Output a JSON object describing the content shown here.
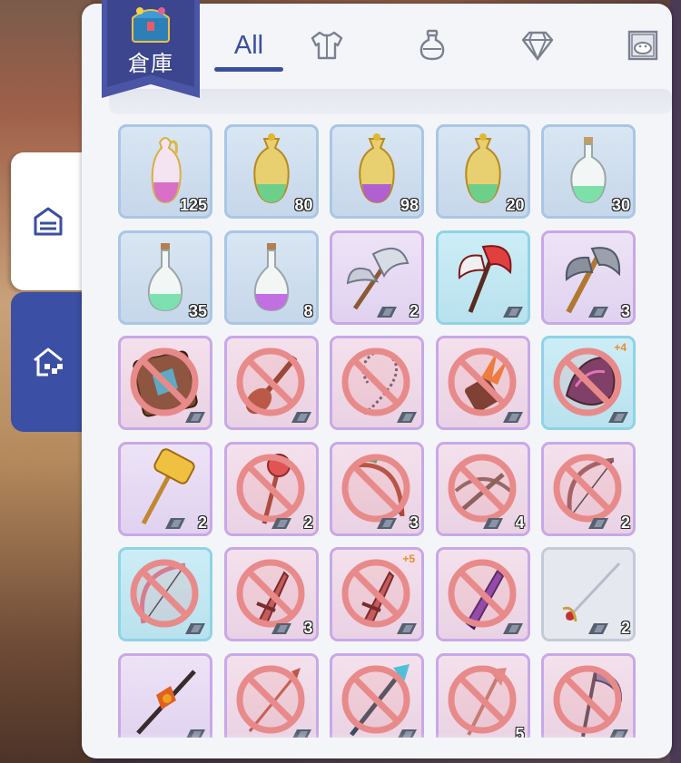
{
  "window": {
    "title": "倉庫"
  },
  "side_tabs": [
    {
      "name": "storage",
      "icon": "storage-box-icon",
      "active": true
    },
    {
      "name": "guild-storage",
      "icon": "guild-house-icon",
      "active": false
    }
  ],
  "tabs": [
    {
      "label": "All",
      "icon": null,
      "active": true
    },
    {
      "label": "",
      "icon": "armor-icon",
      "active": false
    },
    {
      "label": "",
      "icon": "potion-icon",
      "active": false
    },
    {
      "label": "",
      "icon": "gem-icon",
      "active": false
    },
    {
      "label": "",
      "icon": "card-icon",
      "active": false
    }
  ],
  "colors": {
    "accent": "#3a4fa0",
    "slot_blue": "#a9c6e6",
    "slot_purple": "#c8a8e8",
    "slot_teal": "#8fd3e6",
    "refine_orange": "#f08a2a",
    "forbid_red": "#e88a8a"
  },
  "items": [
    {
      "name": "pink-potion-vial",
      "rarity": "blue",
      "qty": "125",
      "forbidden": false,
      "lock": false,
      "refine": ""
    },
    {
      "name": "green-ornate-flask",
      "rarity": "blue",
      "qty": "80",
      "forbidden": false,
      "lock": false,
      "refine": ""
    },
    {
      "name": "purple-ornate-flask",
      "rarity": "blue",
      "qty": "98",
      "forbidden": false,
      "lock": false,
      "refine": ""
    },
    {
      "name": "green-ornate-flask",
      "rarity": "blue",
      "qty": "20",
      "forbidden": false,
      "lock": false,
      "refine": ""
    },
    {
      "name": "green-round-flask",
      "rarity": "blue",
      "qty": "30",
      "forbidden": false,
      "lock": false,
      "refine": ""
    },
    {
      "name": "green-bottle",
      "rarity": "blue",
      "qty": "35",
      "forbidden": false,
      "lock": false,
      "refine": ""
    },
    {
      "name": "purple-bottle",
      "rarity": "blue",
      "qty": "8",
      "forbidden": false,
      "lock": false,
      "refine": ""
    },
    {
      "name": "silver-battle-axe",
      "rarity": "purple",
      "qty": "2",
      "forbidden": false,
      "lock": true,
      "refine": ""
    },
    {
      "name": "red-axe",
      "rarity": "teal",
      "qty": "",
      "forbidden": false,
      "lock": true,
      "refine": ""
    },
    {
      "name": "wooden-axe",
      "rarity": "purple",
      "qty": "3",
      "forbidden": false,
      "lock": true,
      "refine": ""
    },
    {
      "name": "spell-book",
      "rarity": "pink",
      "qty": "",
      "forbidden": true,
      "lock": true,
      "refine": ""
    },
    {
      "name": "guitar",
      "rarity": "pink",
      "qty": "",
      "forbidden": true,
      "lock": true,
      "refine": ""
    },
    {
      "name": "rosary-whip",
      "rarity": "pink",
      "qty": "",
      "forbidden": true,
      "lock": true,
      "refine": ""
    },
    {
      "name": "flame-katar",
      "rarity": "pink",
      "qty": "",
      "forbidden": true,
      "lock": true,
      "refine": ""
    },
    {
      "name": "demon-claw",
      "rarity": "teal",
      "qty": "",
      "forbidden": true,
      "lock": true,
      "refine": "+4"
    },
    {
      "name": "golden-hammer",
      "rarity": "purple",
      "qty": "2",
      "forbidden": false,
      "lock": true,
      "refine": ""
    },
    {
      "name": "red-mace",
      "rarity": "pink",
      "qty": "2",
      "forbidden": true,
      "lock": true,
      "refine": ""
    },
    {
      "name": "vine-bow",
      "rarity": "pink",
      "qty": "3",
      "forbidden": true,
      "lock": true,
      "refine": ""
    },
    {
      "name": "crossbow",
      "rarity": "pink",
      "qty": "4",
      "forbidden": true,
      "lock": true,
      "refine": ""
    },
    {
      "name": "long-bow",
      "rarity": "pink",
      "qty": "2",
      "forbidden": true,
      "lock": true,
      "refine": ""
    },
    {
      "name": "pink-bow",
      "rarity": "teal",
      "qty": "",
      "forbidden": true,
      "lock": true,
      "refine": ""
    },
    {
      "name": "red-dagger",
      "rarity": "pink",
      "qty": "3",
      "forbidden": true,
      "lock": true,
      "refine": ""
    },
    {
      "name": "red-dagger",
      "rarity": "pink",
      "qty": "",
      "forbidden": true,
      "lock": true,
      "refine": "+5"
    },
    {
      "name": "purple-spear-tip",
      "rarity": "pink",
      "qty": "",
      "forbidden": true,
      "lock": true,
      "refine": ""
    },
    {
      "name": "rapier",
      "rarity": "plain",
      "qty": "2",
      "forbidden": false,
      "lock": true,
      "refine": ""
    },
    {
      "name": "dark-spear",
      "rarity": "purple",
      "qty": "",
      "forbidden": false,
      "lock": true,
      "refine": ""
    },
    {
      "name": "thin-spear",
      "rarity": "pink",
      "qty": "",
      "forbidden": true,
      "lock": true,
      "refine": ""
    },
    {
      "name": "blue-trident",
      "rarity": "pink",
      "qty": "",
      "forbidden": true,
      "lock": true,
      "refine": ""
    },
    {
      "name": "pink-staff",
      "rarity": "pink",
      "qty": "5",
      "forbidden": true,
      "lock": false,
      "refine": ""
    },
    {
      "name": "scythe",
      "rarity": "pink",
      "qty": "",
      "forbidden": true,
      "lock": true,
      "refine": ""
    }
  ]
}
